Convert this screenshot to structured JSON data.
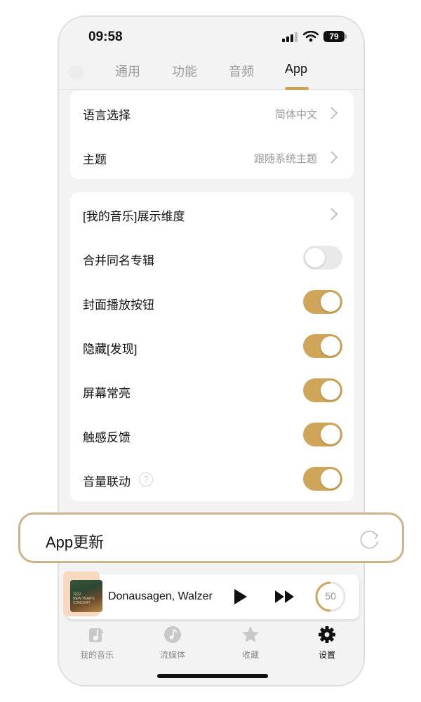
{
  "status": {
    "time": "09:58",
    "battery": "79"
  },
  "tabs": [
    {
      "label": "通用",
      "active": false
    },
    {
      "label": "功能",
      "active": false
    },
    {
      "label": "音频",
      "active": false
    },
    {
      "label": "App",
      "active": true
    }
  ],
  "accent_color": "#cfa659",
  "card1": {
    "language": {
      "label": "语言选择",
      "value": "简体中文"
    },
    "theme": {
      "label": "主题",
      "value": "跟随系统主题"
    }
  },
  "card2": {
    "rows": [
      {
        "label": "[我的音乐]展示维度",
        "type": "link"
      },
      {
        "label": "合并同名专辑",
        "type": "toggle",
        "on": false
      },
      {
        "label": "封面播放按钮",
        "type": "toggle",
        "on": true
      },
      {
        "label": "隐藏[发现]",
        "type": "toggle",
        "on": true
      },
      {
        "label": "屏幕常亮",
        "type": "toggle",
        "on": true
      },
      {
        "label": "触感反馈",
        "type": "toggle",
        "on": true
      },
      {
        "label": "音量联动",
        "type": "toggle",
        "on": true,
        "help": "?"
      }
    ]
  },
  "update": {
    "label": "App更新"
  },
  "player": {
    "track": "Donausagen, Walzer",
    "volume": "50",
    "cover_text": [
      "2022",
      "NEW YEAR'S",
      "CONCERT"
    ]
  },
  "nav": [
    {
      "label": "我的音乐",
      "icon": "music-note-icon",
      "active": false
    },
    {
      "label": "流媒体",
      "icon": "streaming-icon",
      "active": false
    },
    {
      "label": "收藏",
      "icon": "star-icon",
      "active": false
    },
    {
      "label": "设置",
      "icon": "gear-icon",
      "active": true
    }
  ]
}
